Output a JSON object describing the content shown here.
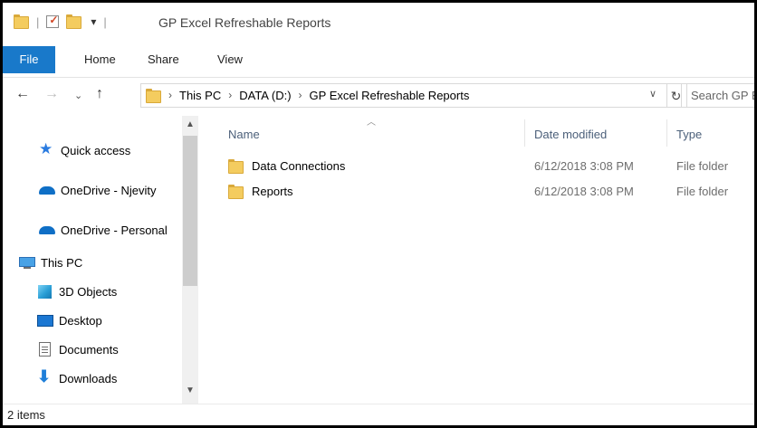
{
  "window": {
    "title": "GP Excel Refreshable Reports",
    "qat_dropdown": "▾"
  },
  "ribbon": {
    "tabs": [
      "File",
      "Home",
      "Share",
      "View"
    ],
    "accent": "#1979ca"
  },
  "address": {
    "breadcrumbs": [
      "This PC",
      "DATA (D:)",
      "GP Excel Refreshable Reports"
    ],
    "search_placeholder": "Search GP Excel Refreshable Reports"
  },
  "nav_pane": {
    "items": [
      {
        "label": "Quick access",
        "icon": "star-icon"
      },
      {
        "label": "OneDrive - Njevity",
        "icon": "onedrive-icon"
      },
      {
        "label": "OneDrive - Personal",
        "icon": "onedrive-icon"
      },
      {
        "label": "This PC",
        "icon": "computer-icon"
      },
      {
        "label": "3D Objects",
        "icon": "cube-icon"
      },
      {
        "label": "Desktop",
        "icon": "desktop-icon"
      },
      {
        "label": "Documents",
        "icon": "document-icon"
      },
      {
        "label": "Downloads",
        "icon": "download-icon"
      }
    ]
  },
  "file_list": {
    "columns": [
      "Name",
      "Date modified",
      "Type"
    ],
    "rows": [
      {
        "name": "Data Connections",
        "date": "6/12/2018 3:08 PM",
        "type": "File folder"
      },
      {
        "name": "Reports",
        "date": "6/12/2018 3:08 PM",
        "type": "File folder"
      }
    ]
  },
  "status": {
    "item_count": "2 items"
  }
}
